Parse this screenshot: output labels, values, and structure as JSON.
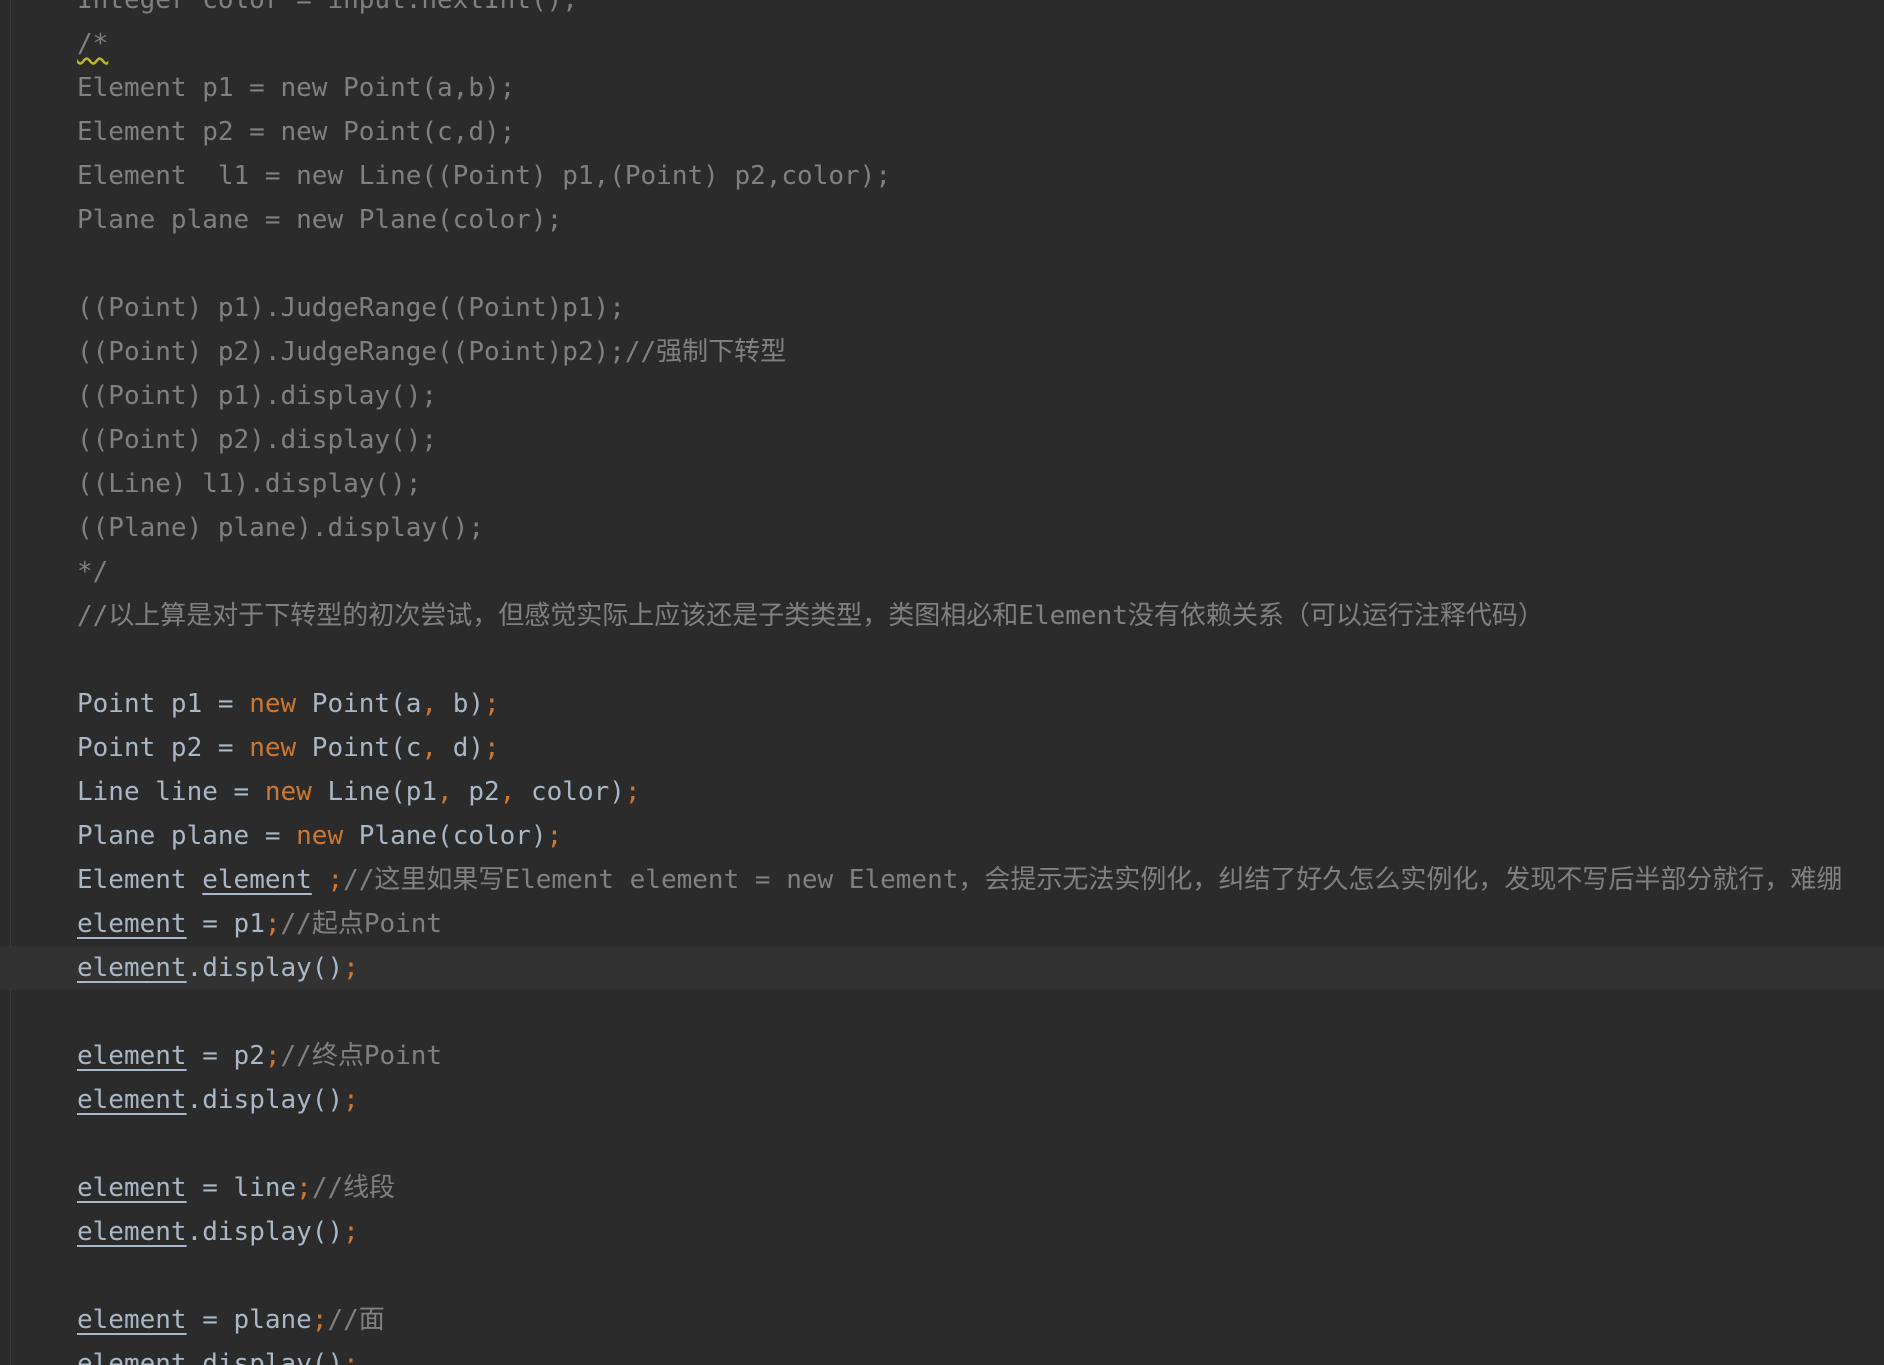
{
  "colors": {
    "background": "#2b2b2b",
    "current_line": "#323232",
    "plain": "#a9b7c6",
    "comment": "#808080",
    "keyword": "#cc7832",
    "warning_underline": "#bbb529"
  },
  "lines": [
    [
      {
        "t": "Integer color = input.nextInt();",
        "c": "comment"
      }
    ],
    [
      {
        "t": "/*",
        "c": "warn"
      }
    ],
    [
      {
        "t": "Element p1 = new Point(a,b);",
        "c": "comment"
      }
    ],
    [
      {
        "t": "Element p2 = new Point(c,d);",
        "c": "comment"
      }
    ],
    [
      {
        "t": "Element  l1 = new Line((Point) p1,(Point) p2,color);",
        "c": "comment"
      }
    ],
    [
      {
        "t": "Plane plane = new Plane(color);",
        "c": "comment"
      }
    ],
    [],
    [
      {
        "t": "((Point) p1).JudgeRange((Point)p1);",
        "c": "comment"
      }
    ],
    [
      {
        "t": "((Point) p2).JudgeRange((Point)p2);//强制下转型",
        "c": "comment"
      }
    ],
    [
      {
        "t": "((Point) p1).display();",
        "c": "comment"
      }
    ],
    [
      {
        "t": "((Point) p2).display();",
        "c": "comment"
      }
    ],
    [
      {
        "t": "((Line) l1).display();",
        "c": "comment"
      }
    ],
    [
      {
        "t": "((Plane) plane).display();",
        "c": "comment"
      }
    ],
    [
      {
        "t": "*/",
        "c": "comment"
      }
    ],
    [
      {
        "t": "//以上算是对于下转型的初次尝试，但感觉实际上应该还是子类类型，类图相必和Element没有依赖关系（可以运行注释代码）",
        "c": "comment"
      }
    ],
    [],
    [
      {
        "t": "Point p1 = ",
        "c": "plain"
      },
      {
        "t": "new",
        "c": "keyword"
      },
      {
        "t": " Point(a",
        "c": "plain"
      },
      {
        "t": ",",
        "c": "punct"
      },
      {
        "t": " b)",
        "c": "plain"
      },
      {
        "t": ";",
        "c": "punct"
      }
    ],
    [
      {
        "t": "Point p2 = ",
        "c": "plain"
      },
      {
        "t": "new",
        "c": "keyword"
      },
      {
        "t": " Point(c",
        "c": "plain"
      },
      {
        "t": ",",
        "c": "punct"
      },
      {
        "t": " d)",
        "c": "plain"
      },
      {
        "t": ";",
        "c": "punct"
      }
    ],
    [
      {
        "t": "Line line = ",
        "c": "plain"
      },
      {
        "t": "new",
        "c": "keyword"
      },
      {
        "t": " Line(p1",
        "c": "plain"
      },
      {
        "t": ",",
        "c": "punct"
      },
      {
        "t": " p2",
        "c": "plain"
      },
      {
        "t": ",",
        "c": "punct"
      },
      {
        "t": " color)",
        "c": "plain"
      },
      {
        "t": ";",
        "c": "punct"
      }
    ],
    [
      {
        "t": "Plane plane = ",
        "c": "plain"
      },
      {
        "t": "new",
        "c": "keyword"
      },
      {
        "t": " Plane(color)",
        "c": "plain"
      },
      {
        "t": ";",
        "c": "punct"
      }
    ],
    [
      {
        "t": "Element ",
        "c": "plain"
      },
      {
        "t": "element",
        "c": "var"
      },
      {
        "t": " ",
        "c": "plain"
      },
      {
        "t": ";",
        "c": "punct"
      },
      {
        "t": "//这里如果写Element element = new Element，会提示无法实例化，纠结了好久怎么实例化，发现不写后半部分就行，难绷",
        "c": "comment"
      }
    ],
    [
      {
        "t": "element",
        "c": "var"
      },
      {
        "t": " = p1",
        "c": "plain"
      },
      {
        "t": ";",
        "c": "punct"
      },
      {
        "t": "//起点Point",
        "c": "comment"
      }
    ],
    [
      {
        "t": "element",
        "c": "var"
      },
      {
        "t": ".display()",
        "c": "plain"
      },
      {
        "t": ";",
        "c": "punct"
      }
    ],
    [],
    [
      {
        "t": "element",
        "c": "var"
      },
      {
        "t": " = p2",
        "c": "plain"
      },
      {
        "t": ";",
        "c": "punct"
      },
      {
        "t": "//终点Point",
        "c": "comment"
      }
    ],
    [
      {
        "t": "element",
        "c": "var"
      },
      {
        "t": ".display()",
        "c": "plain"
      },
      {
        "t": ";",
        "c": "punct"
      }
    ],
    [],
    [
      {
        "t": "element",
        "c": "var"
      },
      {
        "t": " = line",
        "c": "plain"
      },
      {
        "t": ";",
        "c": "punct"
      },
      {
        "t": "//线段",
        "c": "comment"
      }
    ],
    [
      {
        "t": "element",
        "c": "var"
      },
      {
        "t": ".display()",
        "c": "plain"
      },
      {
        "t": ";",
        "c": "punct"
      }
    ],
    [],
    [
      {
        "t": "element",
        "c": "var"
      },
      {
        "t": " = plane",
        "c": "plain"
      },
      {
        "t": ";",
        "c": "punct"
      },
      {
        "t": "//面",
        "c": "comment"
      }
    ],
    [
      {
        "t": "element",
        "c": "var"
      },
      {
        "t": ".display()",
        "c": "plain"
      },
      {
        "t": ";",
        "c": "punct"
      }
    ]
  ]
}
